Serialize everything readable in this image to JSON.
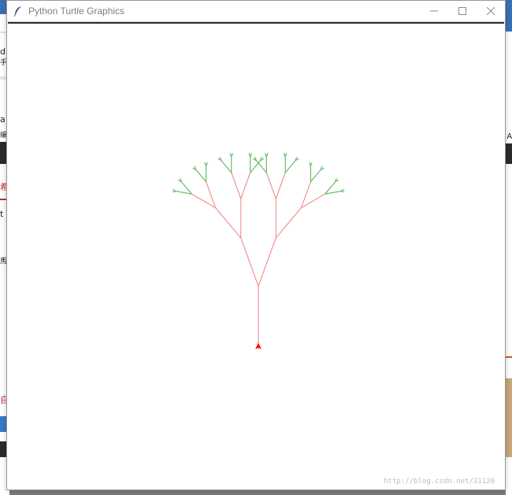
{
  "window": {
    "title": "Python Turtle Graphics",
    "controls": [
      "minimize",
      "maximize",
      "close"
    ]
  },
  "canvas": {
    "background": "#ffffff",
    "trunk_color": "#f08080",
    "leaf_color": "#4caf50",
    "turtle_color": "#ff0000",
    "turtle_shape": "arrow",
    "turtle_heading": "up"
  },
  "tree": {
    "trunk_length": 80,
    "length_decrement": 15,
    "branch_angle_deg": 20,
    "leaf_threshold": 30
  },
  "background": {
    "left_chars": [
      "d",
      "手",
      "a",
      "编",
      "希",
      "t",
      "馬",
      "自"
    ],
    "right_chars": [
      "A"
    ]
  },
  "watermark": "http://blog.csdn.net/31120"
}
